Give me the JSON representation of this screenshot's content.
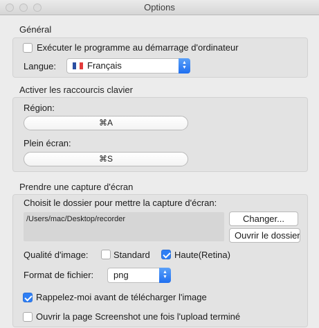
{
  "window": {
    "title": "Options"
  },
  "general": {
    "title": "Général",
    "startup_label": "Exécuter le programme au démarrage d'ordinateur",
    "startup_checked": false,
    "language_label": "Langue:",
    "language_value": "Français",
    "language_flag": "french-flag-icon"
  },
  "shortcuts": {
    "title": "Activer les raccourcis clavier",
    "region_label": "Région:",
    "region_value": "⌘A",
    "fullscreen_label": "Plein écran:",
    "fullscreen_value": "⌘S"
  },
  "capture": {
    "title": "Prendre une capture d'écran",
    "folder_label": "Choisit le dossier pour mettre la capture d'écran:",
    "folder_path": "/Users/mac/Desktop/recorder",
    "change_button": "Changer...",
    "open_button": "Ouvrir le dossier",
    "quality_label": "Qualité d'image:",
    "quality_standard": "Standard",
    "quality_standard_checked": false,
    "quality_high": "Haute(Retina)",
    "quality_high_checked": true,
    "format_label": "Format de fichier:",
    "format_value": "png",
    "remind_label": "Rappelez-moi avant de télécharger l'image",
    "remind_checked": true,
    "open_page_label": "Ouvrir la page Screenshot une fois l'upload terminé",
    "open_page_checked": false
  },
  "colors": {
    "accent": "#2f7ff5",
    "background": "#ececec",
    "group": "#e3e3e3"
  }
}
